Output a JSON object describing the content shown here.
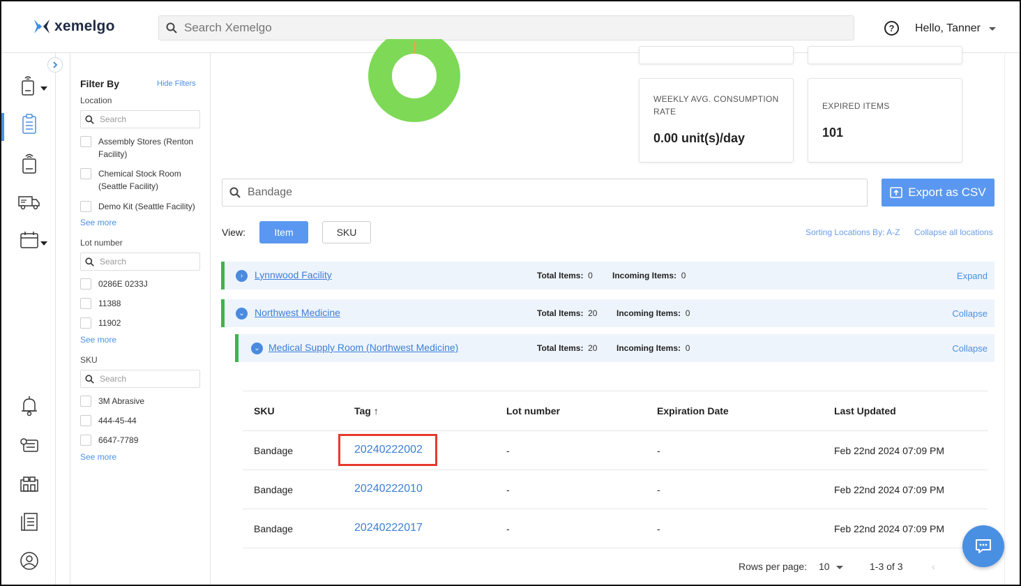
{
  "app": {
    "logo_text": "xemelgo",
    "brand_color": "#1f2a44",
    "accent": "#5a97f0"
  },
  "header": {
    "search_placeholder": "Search Xemelgo",
    "greeting": "Hello, Tanner",
    "help_icon": "help-circle-icon"
  },
  "rail": {
    "icons": [
      "rfid-reader-icon",
      "clipboard-list-icon",
      "badge-reader-icon",
      "truck-icon",
      "calendar-icon",
      "alarm-bell-icon",
      "settings-list-icon",
      "warehouse-icon",
      "report-icon",
      "user-circle-icon"
    ]
  },
  "filters": {
    "title": "Filter By",
    "hide": "Hide Filters",
    "location": {
      "label": "Location",
      "search_placeholder": "Search",
      "options": [
        "Assembly Stores (Renton Facility)",
        "Chemical Stock Room (Seattle Facility)",
        "Demo Kit (Seattle Facility)"
      ],
      "see_more": "See more"
    },
    "lot": {
      "label": "Lot number",
      "search_placeholder": "Search",
      "options": [
        "0286E 0233J",
        "11388",
        "11902"
      ],
      "see_more": "See more"
    },
    "sku": {
      "label": "SKU",
      "search_placeholder": "Search",
      "options": [
        "3M Abrasive",
        "444-45-44",
        "6647-7789"
      ],
      "see_more": "See more"
    }
  },
  "metrics": {
    "weekly": {
      "title": "WEEKLY AVG. CONSUMPTION RATE",
      "value": "0.00 unit(s)/day"
    },
    "expired": {
      "title": "EXPIRED ITEMS",
      "value": "101"
    }
  },
  "toolbar": {
    "search_value": "Bandage",
    "export_label": "Export as CSV",
    "view_label": "View:",
    "view_item": "Item",
    "view_sku": "SKU",
    "sorting": "Sorting Locations By: A-Z",
    "collapse_all": "Collapse all locations"
  },
  "locations": [
    {
      "name": "Lynnwood Facility",
      "total_label": "Total Items:",
      "total": "0",
      "incoming_label": "Incoming Items:",
      "incoming": "0",
      "action": "Expand"
    },
    {
      "name": "Northwest Medicine",
      "total_label": "Total Items:",
      "total": "20",
      "incoming_label": "Incoming Items:",
      "incoming": "0",
      "action": "Collapse"
    },
    {
      "name": "Medical Supply Room (Northwest Medicine)",
      "total_label": "Total Items:",
      "total": "20",
      "incoming_label": "Incoming Items:",
      "incoming": "0",
      "action": "Collapse"
    }
  ],
  "table": {
    "headers": [
      "SKU",
      "Tag",
      "Lot number",
      "Expiration Date",
      "Last Updated"
    ],
    "rows": [
      {
        "sku": "Bandage",
        "tag": "20240222002",
        "lot": "-",
        "exp": "-",
        "updated": "Feb 22nd 2024 07:09 PM"
      },
      {
        "sku": "Bandage",
        "tag": "20240222010",
        "lot": "-",
        "exp": "-",
        "updated": "Feb 22nd 2024 07:09 PM"
      },
      {
        "sku": "Bandage",
        "tag": "20240222017",
        "lot": "-",
        "exp": "-",
        "updated": "Feb 22nd 2024 07:09 PM"
      }
    ]
  },
  "pagination": {
    "rows_label": "Rows per page:",
    "rows_value": "10",
    "range": "1-3 of 3"
  },
  "donut": {
    "green_color": "#7ed957",
    "orange_color": "#f5a04a"
  }
}
